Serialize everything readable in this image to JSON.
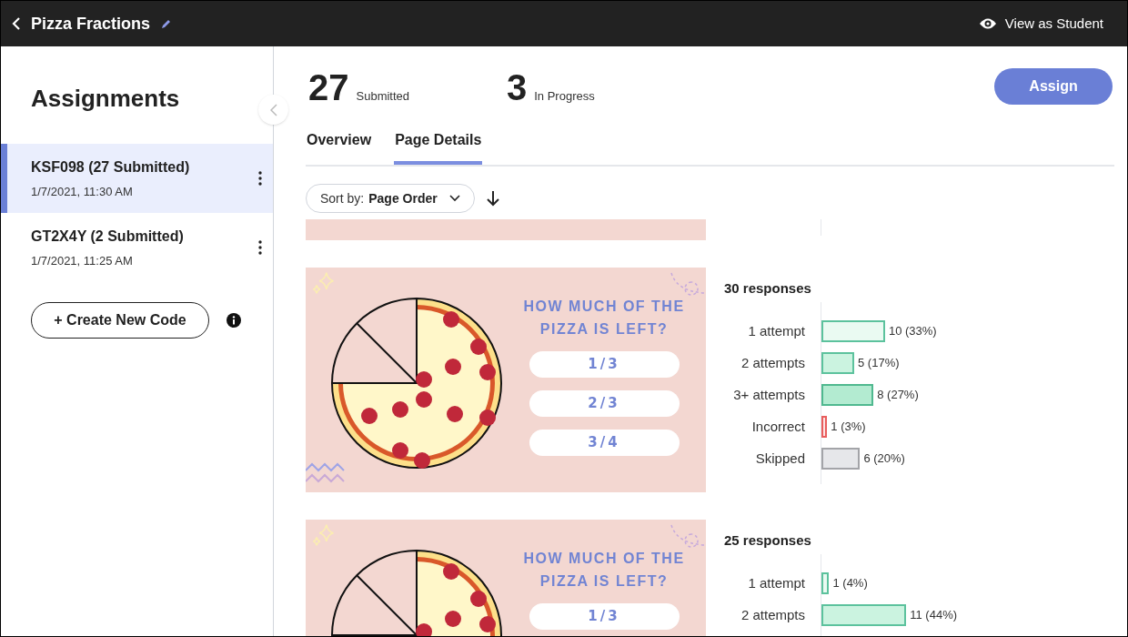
{
  "header": {
    "title": "Pizza Fractions",
    "view_as_student": "View as Student"
  },
  "sidebar": {
    "heading": "Assignments",
    "codes": [
      {
        "code": "KSF098 (27 Submitted)",
        "date": "1/7/2021, 11:30 AM",
        "selected": true
      },
      {
        "code": "GT2X4Y (2 Submitted)",
        "date": "1/7/2021, 11:25 AM",
        "selected": false
      }
    ],
    "create_button": "+ Create New Code"
  },
  "stats": [
    {
      "number": "27",
      "label": "Submitted"
    },
    {
      "number": "3",
      "label": "In Progress"
    }
  ],
  "assign_button": "Assign",
  "tabs": [
    {
      "label": "Overview",
      "selected": false
    },
    {
      "label": "Page Details",
      "selected": true
    }
  ],
  "sort": {
    "prefix": "Sort by:",
    "value": "Page Order"
  },
  "pages": [
    {
      "kind": "partial"
    },
    {
      "kind": "question",
      "slide": {
        "question": "HOW MUCH OF THE PIZZA IS LEFT?",
        "options": [
          "1/3",
          "2/3",
          "3/4"
        ],
        "zigzag": true
      },
      "responses": "30 responses",
      "rows": [
        {
          "label": "1 attempt",
          "count": "10 (33%)",
          "color": "#eafaf2",
          "level": 0.33
        },
        {
          "label": "2 attempts",
          "count": "5 (17%)",
          "color": "#cbf3e0",
          "level": 0.17
        },
        {
          "label": "3+ attempts",
          "count": "8 (27%)",
          "color": "#b3ebd1",
          "level": 0.27
        },
        {
          "label": "Incorrect",
          "count": "1 (3%)",
          "color": "#fde2e2",
          "level": 0.03
        },
        {
          "label": "Skipped",
          "count": "6 (20%)",
          "color": "#e6e7ea",
          "level": 0.2
        }
      ]
    },
    {
      "kind": "question",
      "slide": {
        "question": "HOW MUCH OF THE PIZZA IS LEFT?",
        "options": [
          "1/3"
        ]
      },
      "responses": "25 responses",
      "rows": [
        {
          "label": "1 attempt",
          "count": "1 (4%)",
          "color": "#eafaf2",
          "level": 0.04
        },
        {
          "label": "2 attempts",
          "count": "11 (44%)",
          "color": "#cbf3e0",
          "level": 0.44
        }
      ]
    }
  ]
}
